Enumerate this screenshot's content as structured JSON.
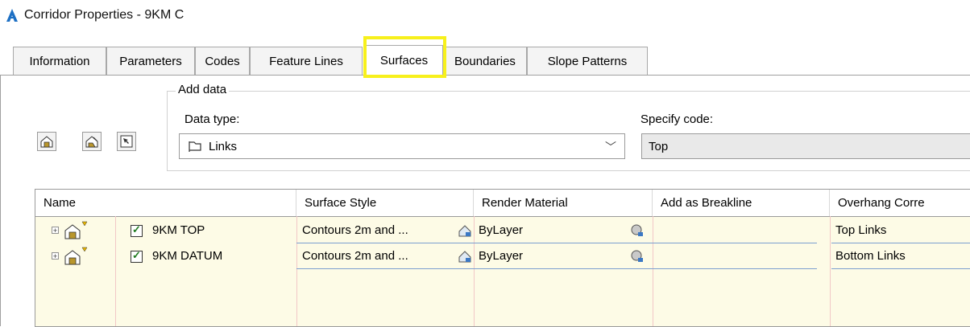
{
  "window": {
    "title": "Corridor Properties - 9KM C"
  },
  "tabs": [
    {
      "label": "Information",
      "active": false
    },
    {
      "label": "Parameters",
      "active": false
    },
    {
      "label": "Codes",
      "active": false
    },
    {
      "label": "Feature Lines",
      "active": false
    },
    {
      "label": "Surfaces",
      "active": true
    },
    {
      "label": "Boundaries",
      "active": false
    },
    {
      "label": "Slope Patterns",
      "active": false
    }
  ],
  "toolbar": {
    "buttons": [
      {
        "icon": "create-surface-icon"
      },
      {
        "icon": "add-surface-item-icon"
      },
      {
        "icon": "pick-object-icon"
      }
    ]
  },
  "add_data": {
    "group_label": "Add data",
    "data_type_label": "Data type:",
    "data_type_value": "Links",
    "specify_code_label": "Specify code:",
    "specify_code_value": "Top"
  },
  "grid": {
    "columns": [
      "Name",
      "Surface Style",
      "Render Material",
      "Add as Breakline",
      "Overhang Corre"
    ],
    "rows": [
      {
        "name": "9KM TOP",
        "surface_style": "Contours 2m and ...",
        "render_material": "ByLayer",
        "add_as_breakline": "",
        "overhang": "Top Links",
        "checked": true
      },
      {
        "name": "9KM DATUM",
        "surface_style": "Contours 2m and ...",
        "render_material": "ByLayer",
        "add_as_breakline": "",
        "overhang": "Bottom Links",
        "checked": true
      }
    ]
  },
  "colors": {
    "highlight": "#f7f01c",
    "grid_background": "#fdfbe6",
    "accent": "#1e7a1e"
  }
}
